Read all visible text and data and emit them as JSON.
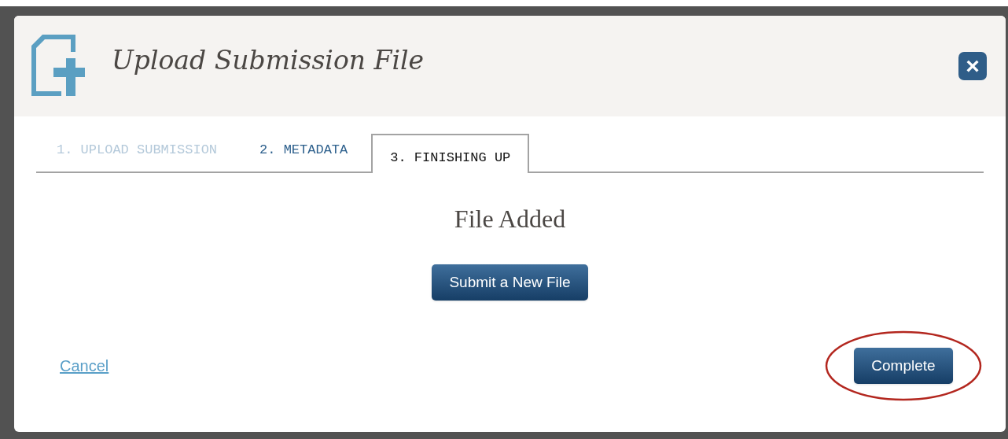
{
  "dialog": {
    "title": "Upload Submission File",
    "close": "×"
  },
  "tabs": [
    {
      "label": "1. UPLOAD SUBMISSION",
      "selected": false,
      "disabled": true
    },
    {
      "label": "2. METADATA",
      "selected": false,
      "disabled": false
    },
    {
      "label": "3. FINISHING UP",
      "selected": true,
      "disabled": false
    }
  ],
  "heading": "File Added",
  "submit_button": "Submit a New File",
  "cancel_link": "Cancel",
  "complete_button": {
    "label": "Complete",
    "circled": true
  }
}
